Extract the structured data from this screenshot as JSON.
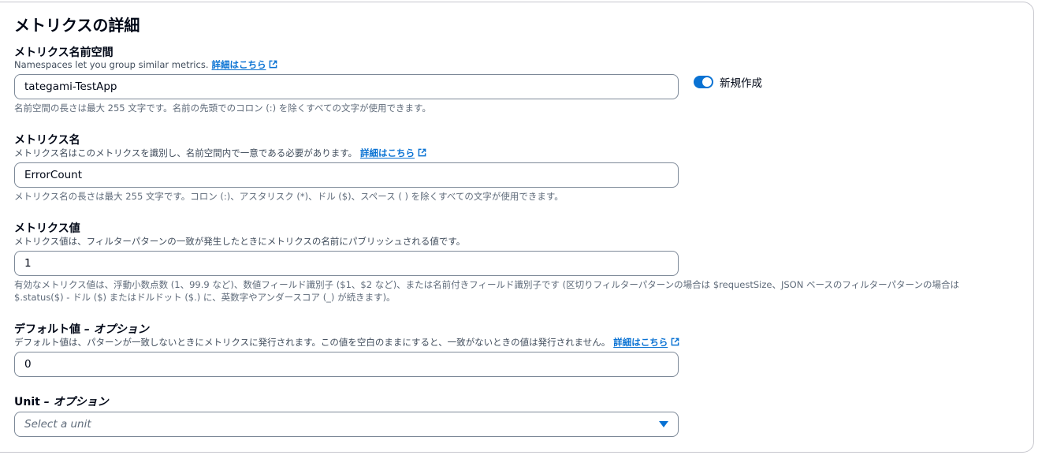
{
  "section": {
    "title": "メトリクスの詳細"
  },
  "namespace": {
    "label": "メトリクス名前空間",
    "description": "Namespaces let you group similar metrics.",
    "link": "詳細はこちら",
    "value": "tategami-TestApp",
    "hint": "名前空間の長さは最大 255 文字です。名前の先頭でのコロン (:) を除くすべての文字が使用できます。",
    "toggle_label": "新規作成"
  },
  "metric_name": {
    "label": "メトリクス名",
    "description": "メトリクス名はこのメトリクスを識別し、名前空間内で一意である必要があります。",
    "link": "詳細はこちら",
    "value": "ErrorCount",
    "hint": "メトリクス名の長さは最大 255 文字です。コロン (:)、アスタリスク (*)、ドル ($)、スペース ( ) を除くすべての文字が使用できます。"
  },
  "metric_value": {
    "label": "メトリクス値",
    "description": "メトリクス値は、フィルターパターンの一致が発生したときにメトリクスの名前にパブリッシュされる値です。",
    "value": "1",
    "hint_line1": "有効なメトリクス値は、浮動小数点数 (1、99.9 など)、数値フィールド識別子 ($1、$2 など)、または名前付きフィールド識別子です (区切りフィルターパターンの場合は $requestSize、JSON ベースのフィルターパターンの場合は",
    "hint_line2": "$.status($) - ドル ($) またはドルドット ($.) に、英数字やアンダースコア (_) が続きます)。"
  },
  "default_value": {
    "label": "デフォルト値",
    "label_optional": " – オプション",
    "description": "デフォルト値は、パターンが一致しないときにメトリクスに発行されます。この値を空白のままにすると、一致がないときの値は発行されません。",
    "link": "詳細はこちら",
    "value": "0"
  },
  "unit": {
    "label": "Unit",
    "label_optional": " – オプション",
    "placeholder": "Select a unit"
  },
  "colors": {
    "accent": "#0972d3",
    "text": "#000716",
    "border": "#7d8998"
  }
}
